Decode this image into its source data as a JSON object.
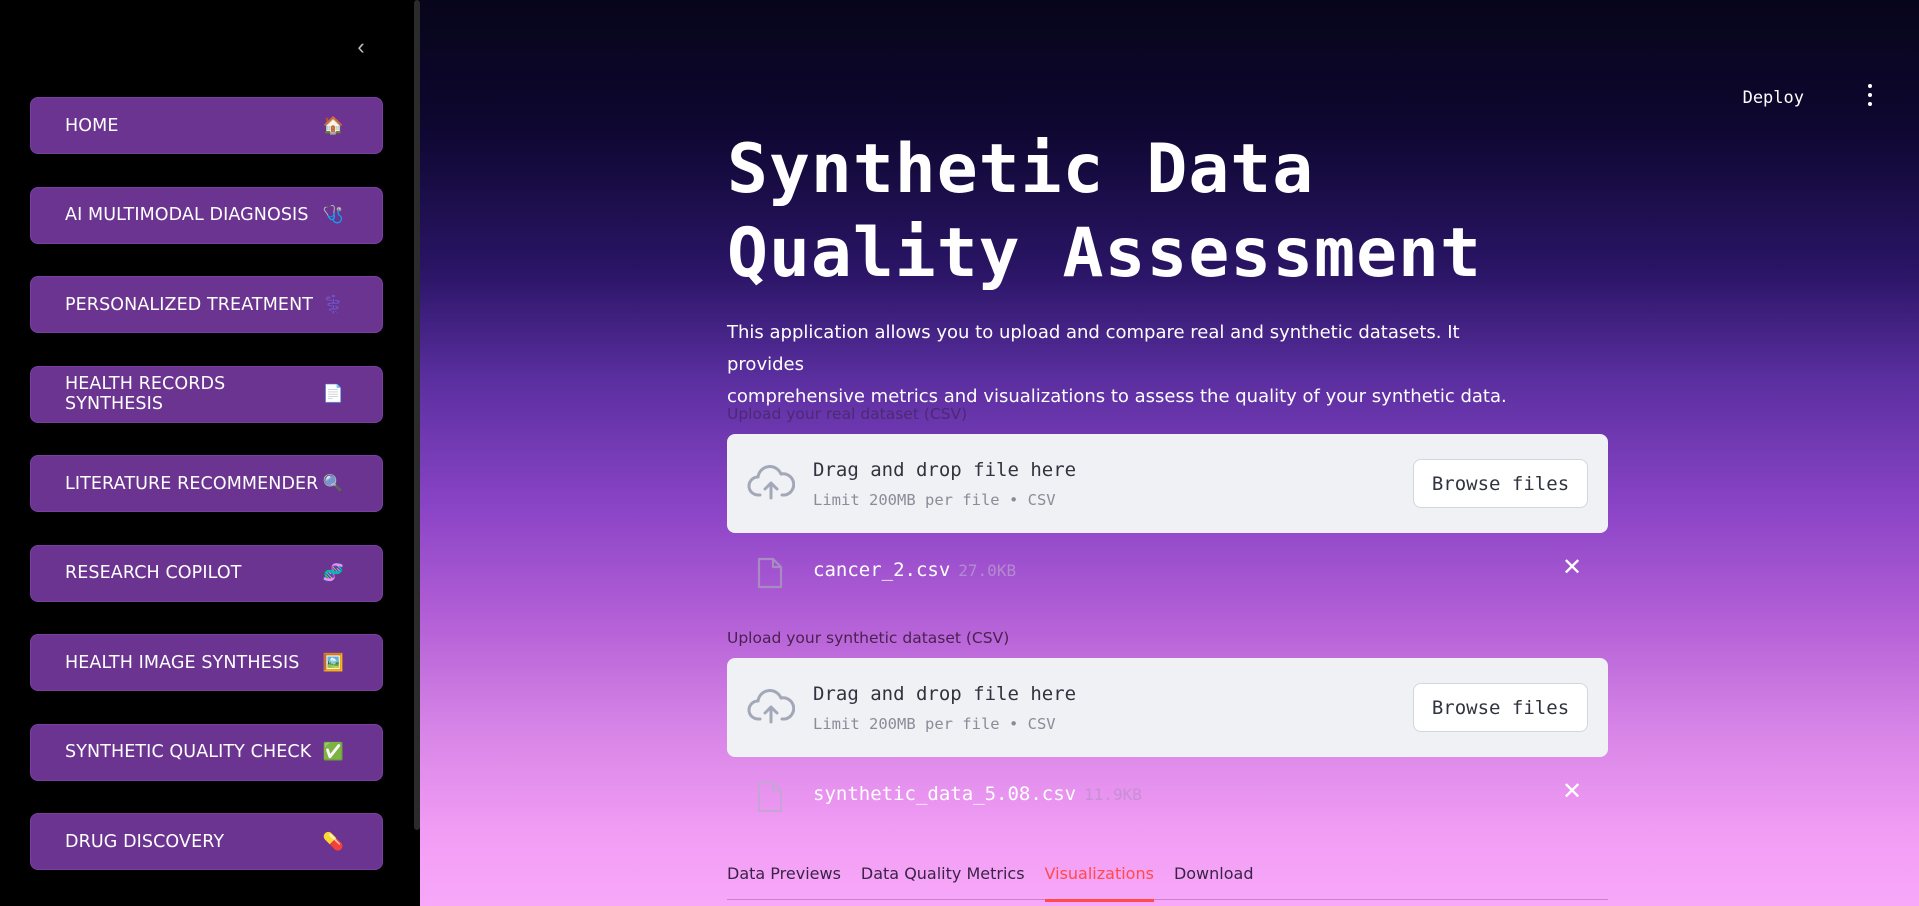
{
  "sidebar": {
    "items": [
      {
        "label": "HOME",
        "icon": "🏠"
      },
      {
        "label": "AI MULTIMODAL DIAGNOSIS",
        "icon": "🩺"
      },
      {
        "label": "PERSONALIZED TREATMENT",
        "icon": "⚕️"
      },
      {
        "label": "HEALTH RECORDS SYNTHESIS",
        "icon": "📄"
      },
      {
        "label": "LITERATURE RECOMMENDER",
        "icon": "🔍"
      },
      {
        "label": "RESEARCH COPILOT",
        "icon": "🧬"
      },
      {
        "label": "HEALTH IMAGE SYNTHESIS",
        "icon": "🖼️"
      },
      {
        "label": "SYNTHETIC QUALITY CHECK",
        "icon": "✅"
      },
      {
        "label": "DRUG DISCOVERY",
        "icon": "💊"
      }
    ],
    "collapse_icon": "chevron-left-icon"
  },
  "header": {
    "deploy_label": "Deploy",
    "menu_icon": "vertical-dots-icon"
  },
  "main": {
    "title_line1": "Synthetic Data",
    "title_line2": "Quality Assessment",
    "description_line1": "This application allows you to upload and compare real and synthetic datasets. It provides",
    "description_line2": "comprehensive metrics and visualizations to assess the quality of your synthetic data.",
    "real_upload": {
      "label": "Upload your real dataset (CSV)",
      "drag_text": "Drag and drop file here",
      "limit_text": "Limit 200MB per file • CSV",
      "browse_label": "Browse files",
      "file_name": "cancer_2.csv",
      "file_size": "27.0KB"
    },
    "synthetic_upload": {
      "label": "Upload your synthetic dataset (CSV)",
      "drag_text": "Drag and drop file here",
      "limit_text": "Limit 200MB per file • CSV",
      "browse_label": "Browse files",
      "file_name": "synthetic_data_5.08.csv",
      "file_size": "11.9KB"
    },
    "tabs": [
      {
        "label": "Data Previews",
        "active": false
      },
      {
        "label": "Data Quality Metrics",
        "active": false
      },
      {
        "label": "Visualizations",
        "active": true
      },
      {
        "label": "Download",
        "active": false
      }
    ]
  },
  "colors": {
    "sidebar_button": "#6b3491",
    "active_tab": "#ff4b4b",
    "dropzone": "#f0f1f4"
  }
}
